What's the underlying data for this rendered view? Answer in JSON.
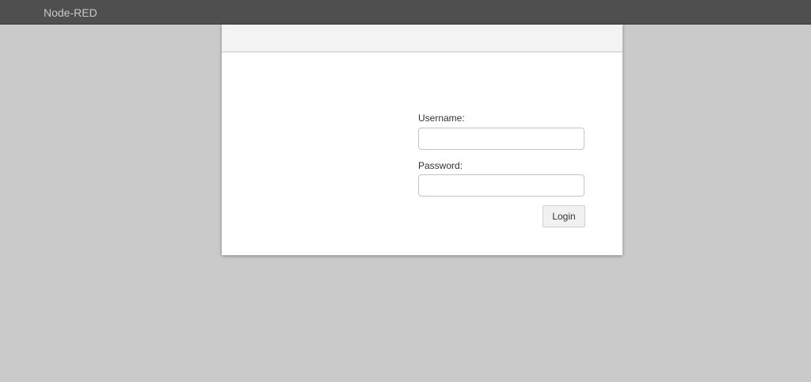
{
  "header": {
    "brand": "Node-RED"
  },
  "login_dialog": {
    "username_label": "Username:",
    "username_value": "",
    "password_label": "Password:",
    "password_value": "",
    "login_button_label": "Login"
  },
  "colors": {
    "header_background": "#4f4f4f",
    "page_background": "#cacaca",
    "dialog_background": "#ffffff",
    "titlebar_background": "#f3f3f3",
    "button_background": "#f1f1f1"
  }
}
